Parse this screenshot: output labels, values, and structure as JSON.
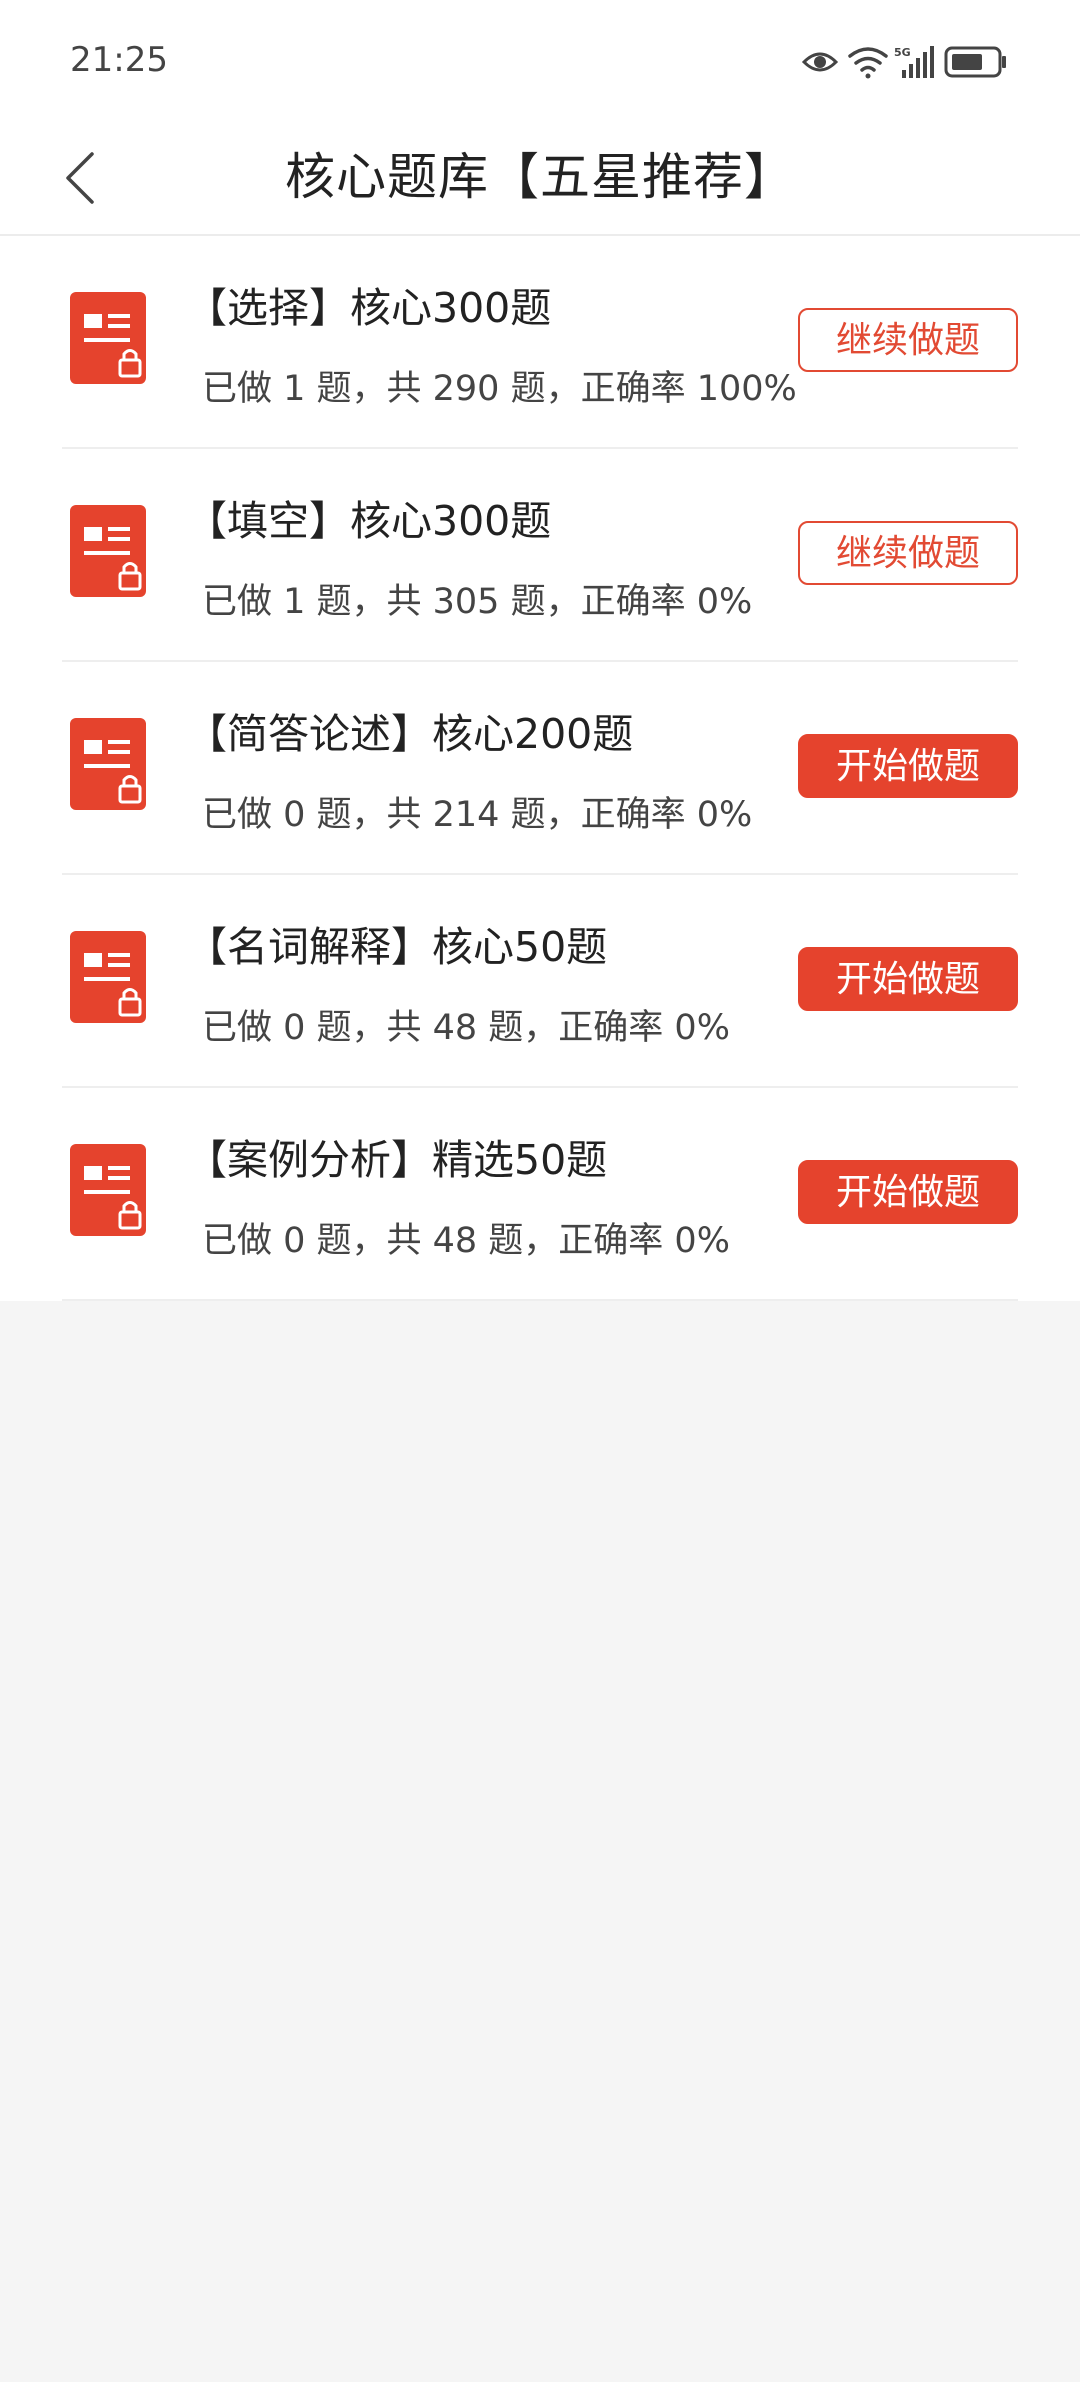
{
  "status": {
    "time": "21:25",
    "network": "5G",
    "icons": [
      "eye-icon",
      "wifi-icon",
      "signal-icon",
      "battery-icon"
    ]
  },
  "nav": {
    "title": "核心题库【五星推荐】",
    "back_icon": "chevron-left-icon"
  },
  "colors": {
    "accent": "#e5432d",
    "background": "#f5f5f5",
    "card": "#ffffff"
  },
  "items": [
    {
      "title": "【选择】核心300题",
      "stats": "已做 1 题，共 290 题，正确率 100%",
      "button": "继续做题",
      "button_style": "outline",
      "icon": "document-lock-icon"
    },
    {
      "title": "【填空】核心300题",
      "stats": "已做 1 题，共 305 题，正确率 0%",
      "button": "继续做题",
      "button_style": "outline",
      "icon": "document-lock-icon"
    },
    {
      "title": "【简答论述】核心200题",
      "stats": "已做 0 题，共 214 题，正确率 0%",
      "button": "开始做题",
      "button_style": "solid",
      "icon": "document-lock-icon"
    },
    {
      "title": "【名词解释】核心50题",
      "stats": "已做 0 题，共 48 题，正确率 0%",
      "button": "开始做题",
      "button_style": "solid",
      "icon": "document-lock-icon"
    },
    {
      "title": "【案例分析】精选50题",
      "stats": "已做 0 题，共 48 题，正确率 0%",
      "button": "开始做题",
      "button_style": "solid",
      "icon": "document-lock-icon"
    }
  ]
}
